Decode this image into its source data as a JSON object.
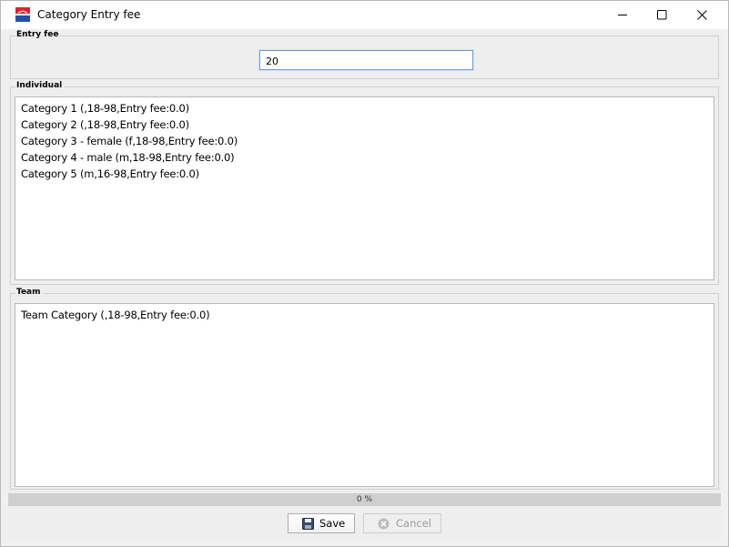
{
  "window": {
    "title": "Category Entry fee",
    "accent": "#1f4fa3"
  },
  "entry_fee": {
    "group_label": "Entry fee",
    "value": "20"
  },
  "individual": {
    "group_label": "Individual",
    "items": [
      "Category 1 (,18-98,Entry fee:0.0)",
      "Category 2 (,18-98,Entry fee:0.0)",
      "Category 3 - female (f,18-98,Entry fee:0.0)",
      "Category 4 - male (m,18-98,Entry fee:0.0)",
      "Category 5 (m,16-98,Entry fee:0.0)"
    ]
  },
  "team": {
    "group_label": "Team",
    "items": [
      "Team Category (,18-98,Entry fee:0.0)"
    ]
  },
  "progress": {
    "label": "0 %",
    "fraction": 0
  },
  "buttons": {
    "save_label": "Save",
    "save_icon": "floppy-disk-icon",
    "cancel_label": "Cancel",
    "cancel_icon": "cancel-icon"
  }
}
